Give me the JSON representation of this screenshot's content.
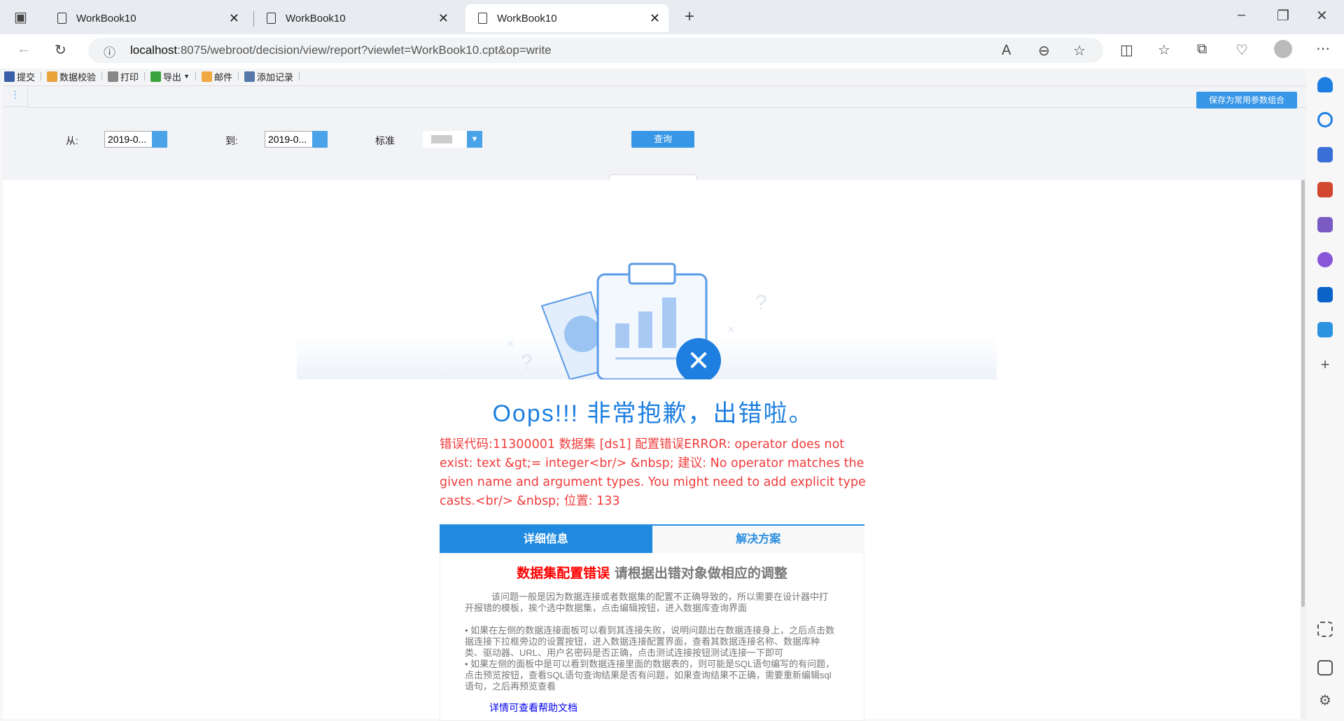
{
  "browser": {
    "tabs": [
      {
        "title": "WorkBook10"
      },
      {
        "title": "WorkBook10"
      },
      {
        "title": "WorkBook10",
        "active": true
      }
    ],
    "url_host": "localhost",
    "url_rest": ":8075/webroot/decision/view/report?viewlet=WorkBook10.cpt&op=write"
  },
  "toolbar": {
    "items": [
      {
        "label": "提交",
        "icon": "save-icon",
        "color": "#3a5fa8"
      },
      {
        "label": "数据校验",
        "icon": "pencil-icon",
        "color": "#e8a33b"
      },
      {
        "label": "打印",
        "icon": "printer-icon",
        "color": "#888888"
      },
      {
        "label": "导出",
        "icon": "export-icon",
        "color": "#3ca33c"
      },
      {
        "label": "邮件",
        "icon": "mail-icon",
        "color": "#f0a840"
      },
      {
        "label": "添加记录",
        "icon": "add-record-icon",
        "color": "#5577aa"
      }
    ]
  },
  "params": {
    "from_label": "从:",
    "from_value": "2019-0...",
    "to_label": "到:",
    "to_value": "2019-0...",
    "standard_label": "标准",
    "query_label": "查询",
    "save_label": "保存为常用参数组合"
  },
  "error": {
    "title": "Oops!!! 非常抱歉，出错啦。",
    "message": "错误代码:11300001 数据集 [ds1] 配置错误ERROR: operator does not exist: text &gt;= integer<br/> &nbsp; 建议: No operator matches the given name and argument types. You might need to add explicit type casts.<br/> &nbsp; 位置: 133",
    "tabs": [
      "详细信息",
      "解决方案"
    ],
    "heading_red": "数据集配置错误",
    "heading_gray": "请根据出错对象做相应的调整",
    "para1": "该问题一般是因为数据连接或者数据集的配置不正确导致的，所以需要在设计器中打开报错的模板，挨个选中数据集，点击编辑按钮，进入数据库查询界面",
    "bullet1": "•  如果在左侧的数据连接面板可以看到其连接失败，说明问题出在数据连接身上，之后点击数据连接下拉框旁边的设置按钮，进入数据连接配置界面，查看其数据连接名称、数据库种类、驱动器、URL、用户名密码是否正确，点击测试连接按钮测试连接一下即可",
    "bullet2": "•  如果左侧的面板中是可以看到数据连接里面的数据表的，则可能是SQL语句编写的有问题，点击预览按钮，查看SQL语句查询结果是否有问题，如果查询结果不正确，需要重新编辑sql语句，之后再预览查看",
    "help_link": "详情可查看帮助文档"
  }
}
